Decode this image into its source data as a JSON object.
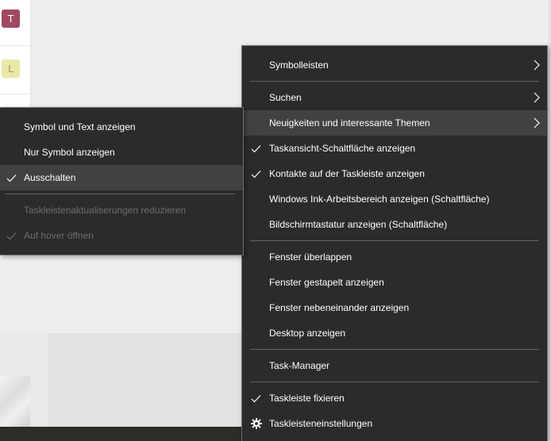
{
  "background": {
    "avatars": [
      {
        "letter": "T",
        "bg": "#a04a62",
        "fg": "#ffffff"
      },
      {
        "letter": "L",
        "bg": "#e9e8a6",
        "fg": "#9a9a46"
      }
    ]
  },
  "main_menu": {
    "items": [
      {
        "label": "Symbolleisten",
        "submenu": true
      },
      {
        "label": "Suchen",
        "submenu": true
      },
      {
        "label": "Neuigkeiten und interessante Themen",
        "submenu": true,
        "highlighted": true
      },
      {
        "label": "Taskansicht-Schaltfläche anzeigen",
        "checked": true
      },
      {
        "label": "Kontakte auf der Taskleiste anzeigen",
        "checked": true
      },
      {
        "label": "Windows Ink-Arbeitsbereich anzeigen (Schaltfläche)"
      },
      {
        "label": "Bildschirmtastatur anzeigen (Schaltfläche)"
      },
      {
        "label": "Fenster überlappen"
      },
      {
        "label": "Fenster gestapelt anzeigen"
      },
      {
        "label": "Fenster nebeneinander anzeigen"
      },
      {
        "label": "Desktop anzeigen"
      },
      {
        "label": "Task-Manager"
      },
      {
        "label": "Taskleiste fixieren",
        "checked": true
      },
      {
        "label": "Taskleisteneinstellungen",
        "icon": "gear-icon"
      }
    ]
  },
  "sub_menu": {
    "items": [
      {
        "label": "Symbol und Text anzeigen"
      },
      {
        "label": "Nur Symbol anzeigen"
      },
      {
        "label": "Ausschalten",
        "checked": true,
        "highlighted": true
      },
      {
        "label": "Taskleistenaktualiserungen reduzieren",
        "disabled": true
      },
      {
        "label": "Auf hover öffnen",
        "checked": true,
        "disabled": true
      }
    ]
  },
  "colors": {
    "menu_bg": "#2b2b2b",
    "menu_highlight": "#414141",
    "menu_text": "#ffffff",
    "menu_disabled_text": "#6d6d6d",
    "separator": "#636363"
  }
}
